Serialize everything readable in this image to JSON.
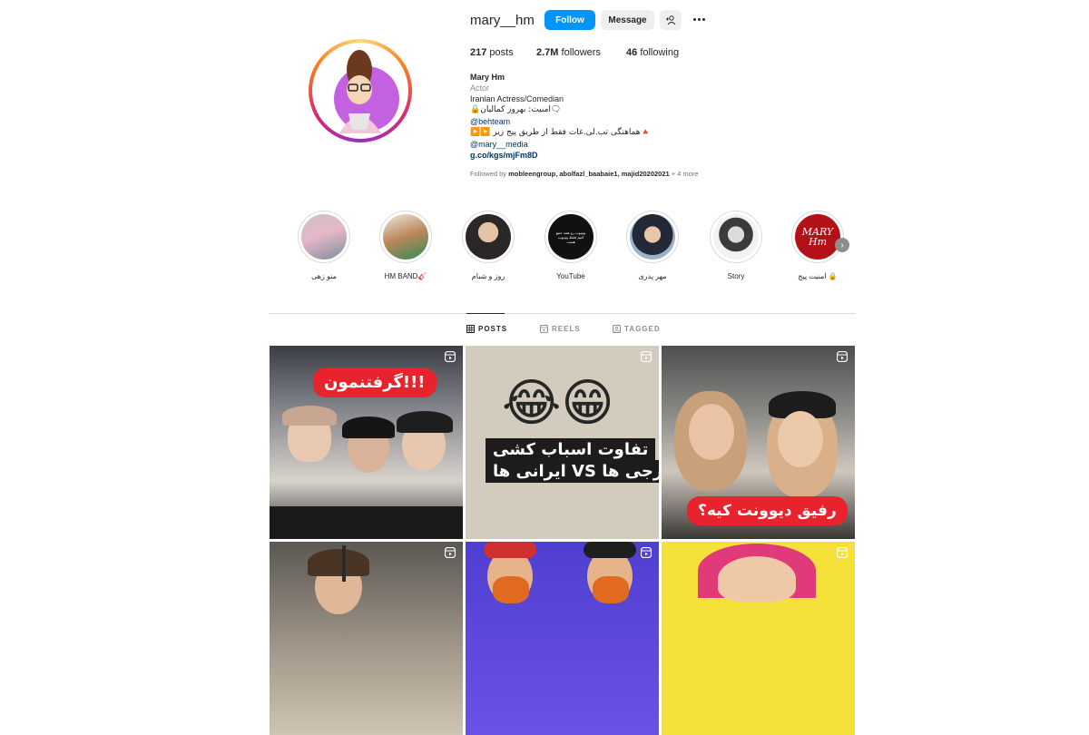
{
  "profile": {
    "username": "mary__hm",
    "follow_label": "Follow",
    "message_label": "Message",
    "posts_count": "217",
    "posts_label": "posts",
    "followers_count": "2.7M",
    "followers_label": "followers",
    "following_count": "46",
    "following_label": "following"
  },
  "bio": {
    "name": "Mary Hm",
    "category": "Actor",
    "line1": "Iranian Actress/Comedian",
    "line2": "🔒امنیت: بهروز کمالیان🗨",
    "mention1": "@behteam",
    "line3": "▶️▶️ هماهنگی تب.لی.غات فقط از طریق پیج زیر🔺",
    "mention2": "@mary__media",
    "link": "g.co/kgs/mjFm8D"
  },
  "followed_by": {
    "prefix": "Followed by",
    "names": "mobleengroup, abolfazl_baabaie1, majid20202021",
    "suffix": "+ 4 more"
  },
  "highlights": [
    {
      "label": "منو زهی"
    },
    {
      "label": "HM BAND🎸"
    },
    {
      "label": "روز و شبام"
    },
    {
      "label": "YouTube"
    },
    {
      "label": "مهر پدری"
    },
    {
      "label": "Story"
    },
    {
      "label": "امنیت پیج 🔒"
    }
  ],
  "highlight_youtube_text": "یوتیوب رو همه جمع کنیم فقط یوتیوب هست",
  "highlight_mary_text": "MARY Hm",
  "tabs": [
    {
      "label": "POSTS",
      "icon": "grid-icon",
      "active": true
    },
    {
      "label": "REELS",
      "icon": "reels-icon",
      "active": false
    },
    {
      "label": "TAGGED",
      "icon": "tagged-icon",
      "active": false
    }
  ],
  "posts": [
    {
      "caption": "گرفتنمون!!!",
      "type": "reel"
    },
    {
      "caption_line1": "تفاوت اسباب کشی",
      "caption_line2": "ایرانی ها VS خارجی ها",
      "emoji": "😂😁",
      "type": "reel"
    },
    {
      "caption": "رفیق دیوونت کیه؟",
      "type": "reel"
    },
    {
      "type": "reel"
    },
    {
      "type": "reel"
    },
    {
      "type": "reel"
    }
  ],
  "colors": {
    "follow_blue": "#0095f6",
    "link_blue": "#00376b",
    "caption_red": "#e8232e"
  }
}
